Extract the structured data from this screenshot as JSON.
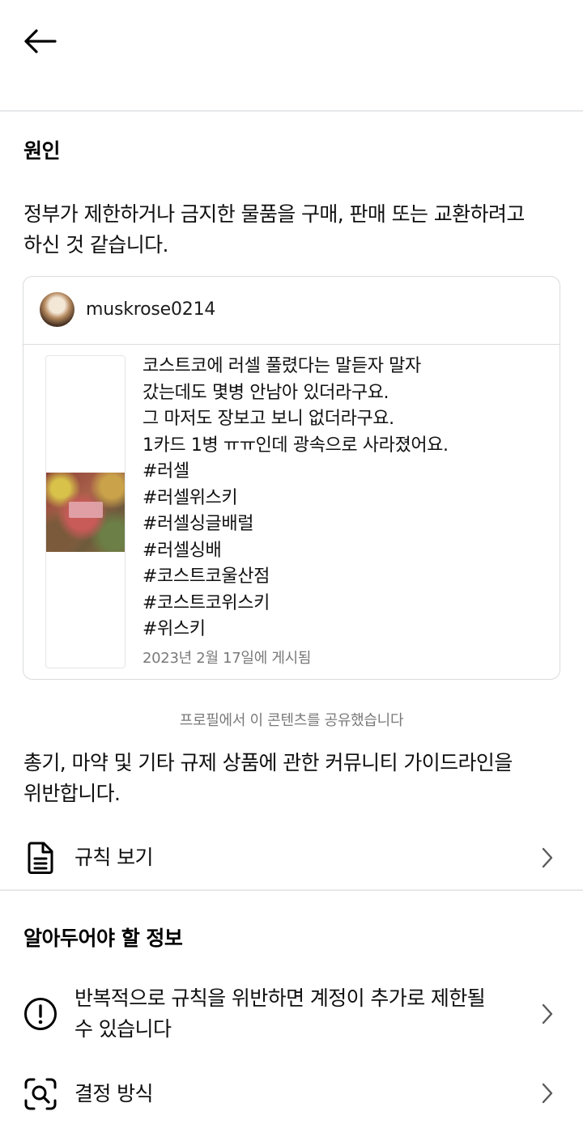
{
  "header": {
    "back_icon": "back-arrow-icon"
  },
  "reason": {
    "title": "원인",
    "text_line1": "정부가 제한하거나 금지한 물품을 구매, 판매 또는 교환하려고",
    "text_line2": "하신 것 같습니다."
  },
  "post": {
    "username": "muskrose0214",
    "lines": [
      "코스트코에 러셀 풀렸다는 말듣자 말자",
      "갔는데도 몇병 안남아 있더라구요.",
      "그 마저도 장보고 보니 없더라구요.",
      "1카드 1병 ㅠㅠ인데 광속으로 사라졌어요.",
      "#러셀",
      "#러셀위스키",
      "#러셀싱글배럴",
      "#러셀싱배",
      "#코스트코울산점",
      "#코스트코위스키",
      "#위스키"
    ],
    "date": "2023년 2월 17일에 게시됨"
  },
  "shared_note": "프로필에서 이 콘텐츠를 공유했습니다",
  "violation": {
    "line1": "총기, 마약 및 기타 규제 상품에 관한 커뮤니티 가이드라인을",
    "line2": "위반합니다."
  },
  "rules_row": {
    "label": "규칙 보기",
    "icon": "document-icon"
  },
  "info": {
    "title": "알아두어야 할 정보",
    "warning_line1": "반복적으로 규칙을 위반하면 계정이 추가로 제한될",
    "warning_line2": "수 있습니다",
    "decision_label": "결정 방식"
  },
  "colors": {
    "divider": "#e6e8ea",
    "muted_text": "#7a7a7a",
    "card_border": "#d9dbdd"
  }
}
